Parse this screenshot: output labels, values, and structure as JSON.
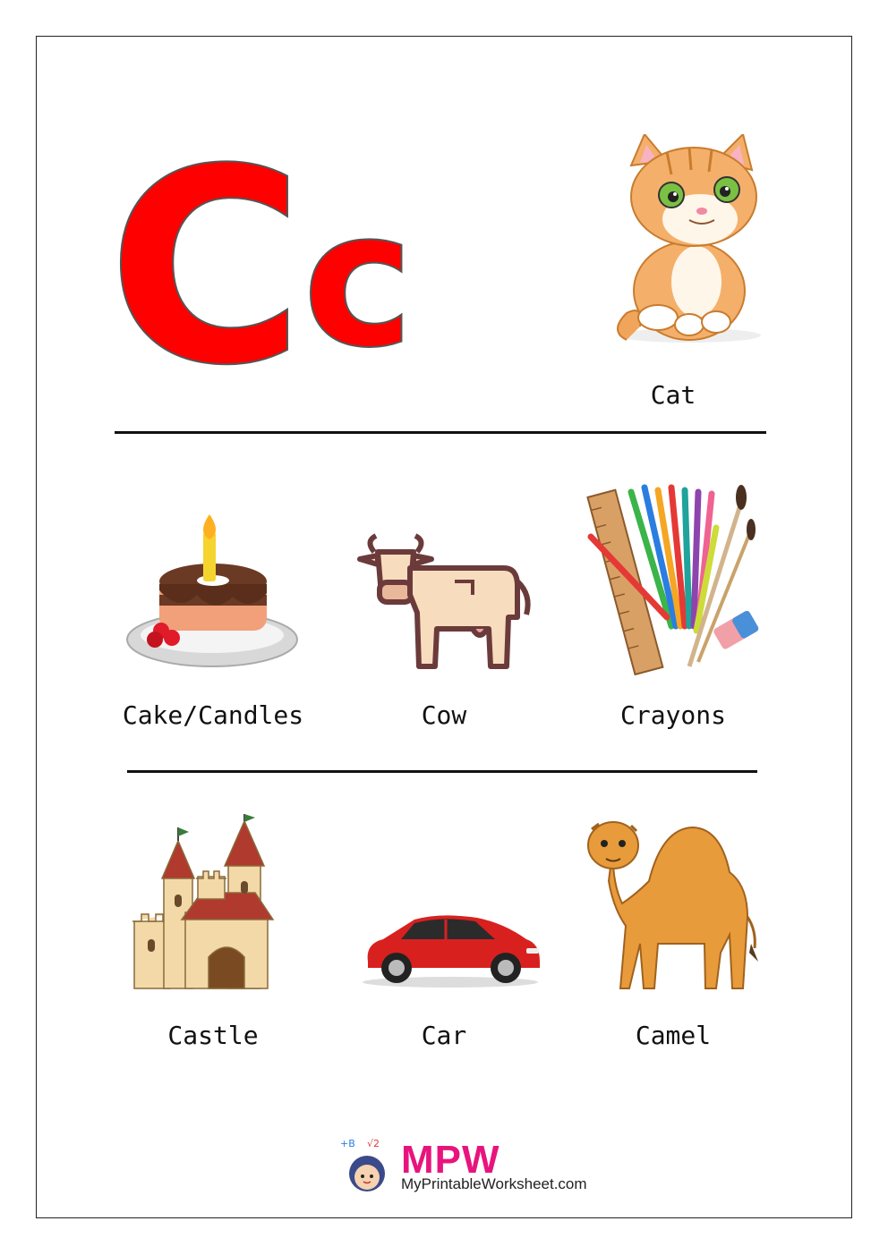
{
  "letters": {
    "upper": "C",
    "lower": "c"
  },
  "items": [
    {
      "label": "Cat",
      "icon": "cat-icon"
    },
    {
      "label": "Cake/Candles",
      "icon": "cake-icon"
    },
    {
      "label": "Cow",
      "icon": "cow-icon"
    },
    {
      "label": "Crayons",
      "icon": "crayons-icon"
    },
    {
      "label": "Castle",
      "icon": "castle-icon"
    },
    {
      "label": "Car",
      "icon": "car-icon"
    },
    {
      "label": "Camel",
      "icon": "camel-icon"
    }
  ],
  "logo": {
    "brand": "MPW",
    "site": "MyPrintableWorksheet.com"
  },
  "colors": {
    "letter": "#ff0000",
    "brand": "#e8147d"
  }
}
